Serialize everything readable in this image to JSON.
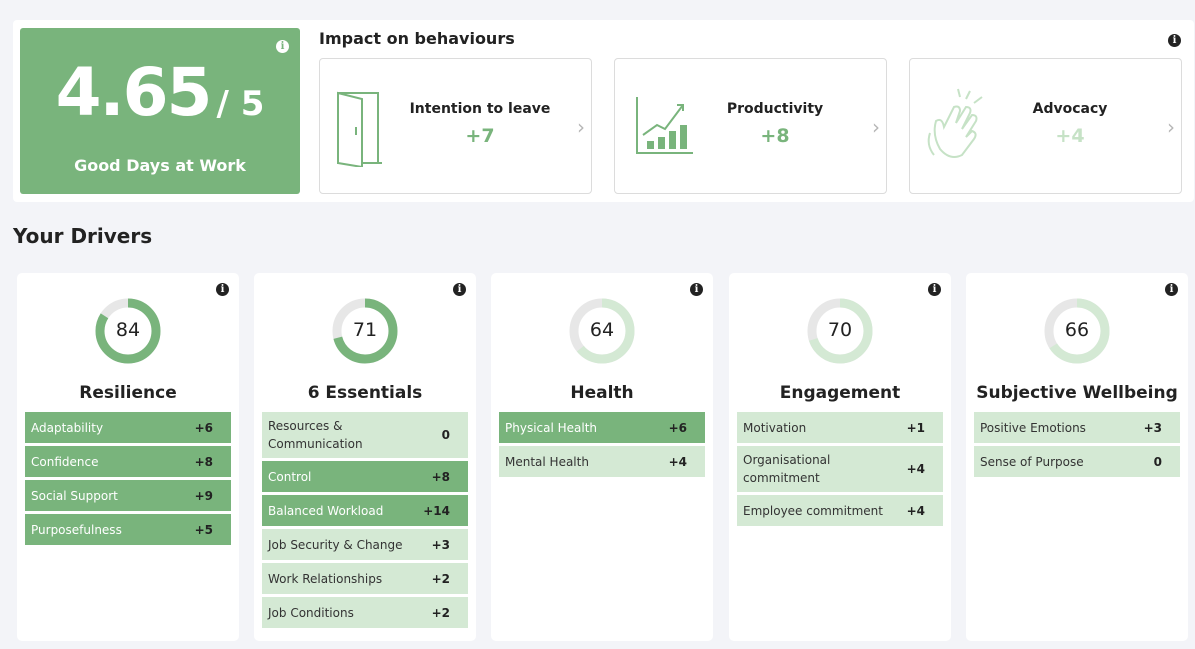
{
  "score": {
    "value": "4.65",
    "max_label": "/ 5",
    "caption": "Good Days at Work",
    "info_icon": "info-icon"
  },
  "impact": {
    "title": "Impact on behaviours",
    "cards": [
      {
        "name": "Intention to leave",
        "value": "+7",
        "icon": "door-icon",
        "chevron": "›"
      },
      {
        "name": "Productivity",
        "value": "+8",
        "icon": "growth-chart-icon",
        "chevron": "›"
      },
      {
        "name": "Advocacy",
        "value": "+4",
        "icon": "clapping-hands-icon",
        "chevron": "›"
      }
    ]
  },
  "drivers": {
    "title": "Your Drivers",
    "cards": [
      {
        "name": "Resilience",
        "score": "84",
        "percent": 84,
        "rows": [
          {
            "label": "Adaptability",
            "value": "+6"
          },
          {
            "label": "Confidence",
            "value": "+8"
          },
          {
            "label": "Social Support",
            "value": "+9"
          },
          {
            "label": "Purposefulness",
            "value": "+5"
          }
        ]
      },
      {
        "name": "6 Essentials",
        "score": "71",
        "percent": 71,
        "rows": [
          {
            "label": "Resources & Communication",
            "value": "0"
          },
          {
            "label": "Control",
            "value": "+8"
          },
          {
            "label": "Balanced Workload",
            "value": "+14"
          },
          {
            "label": "Job Security & Change",
            "value": "+3"
          },
          {
            "label": "Work Relationships",
            "value": "+2"
          },
          {
            "label": "Job Conditions",
            "value": "+2"
          }
        ]
      },
      {
        "name": "Health",
        "score": "64",
        "percent": 64,
        "rows": [
          {
            "label": "Physical Health",
            "value": "+6"
          },
          {
            "label": "Mental Health",
            "value": "+4"
          }
        ]
      },
      {
        "name": "Engagement",
        "score": "70",
        "percent": 70,
        "rows": [
          {
            "label": "Motivation",
            "value": "+1"
          },
          {
            "label": "Organisational commitment",
            "value": "+4"
          },
          {
            "label": "Employee commitment",
            "value": "+4"
          }
        ]
      },
      {
        "name": "Subjective Wellbeing",
        "score": "66",
        "percent": 66,
        "rows": [
          {
            "label": "Positive Emotions",
            "value": "+3"
          },
          {
            "label": "Sense of Purpose",
            "value": "0"
          }
        ]
      }
    ]
  },
  "colors": {
    "brand_green": "#79b47c",
    "light_green": "#d4e9d4",
    "faded_green": "#c6e2c6",
    "ring_track": "#e7e7e7"
  }
}
